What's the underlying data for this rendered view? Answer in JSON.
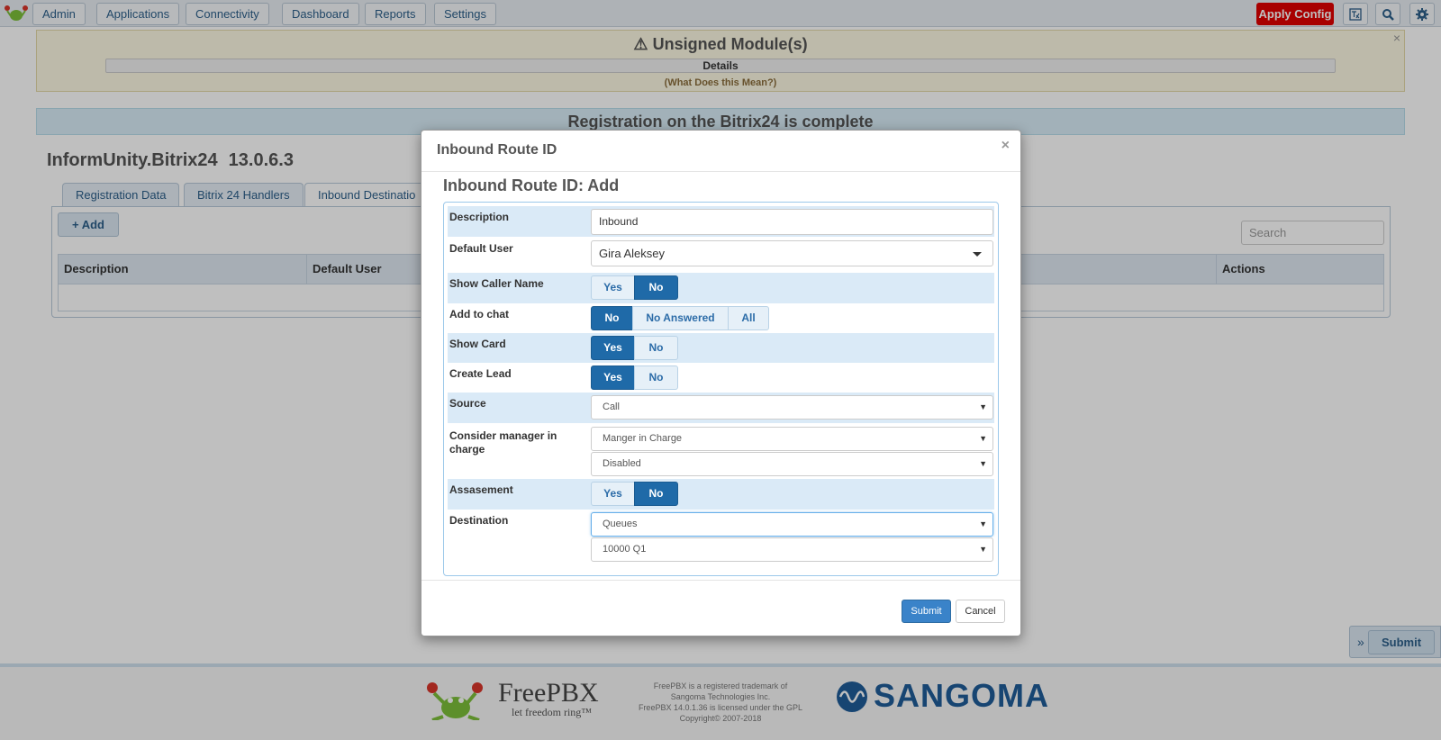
{
  "nav": {
    "items": [
      "Admin",
      "Applications",
      "Connectivity",
      "Dashboard",
      "Reports",
      "Settings"
    ],
    "apply_config": "Apply Config",
    "icons": [
      "translate-icon",
      "search-icon",
      "gear-icon"
    ]
  },
  "alerts": {
    "unsigned_title": "Unsigned Module(s)",
    "details": "Details",
    "what_mean": "(What Does this Mean?)",
    "registration": "Registration on the Bitrix24 is complete"
  },
  "module": {
    "name": "InformUnity.Bitrix24",
    "version": "13.0.6.3"
  },
  "tabs": [
    "Registration Data",
    "Bitrix 24 Handlers",
    "Inbound Destinatio"
  ],
  "list": {
    "add_label": "+ Add",
    "search_placeholder": "Search",
    "columns": [
      "Description",
      "Default User",
      "Actions"
    ]
  },
  "float_submit": "Submit",
  "footer": {
    "freepbx_name": "FreePBX",
    "freepbx_tagline": "let freedom ring™",
    "legal": [
      "FreePBX is a registered trademark of",
      "Sangoma Technologies Inc.",
      "FreePBX 14.0.1.36 is licensed under the GPL",
      "Copyright© 2007-2018"
    ],
    "sangoma": "SANGOMA"
  },
  "modal": {
    "title": "Inbound Route ID",
    "heading": "Inbound Route ID: Add",
    "fields": {
      "description": {
        "label": "Description",
        "value": "Inbound"
      },
      "default_user": {
        "label": "Default User",
        "value": "Gira Aleksey"
      },
      "show_caller_name": {
        "label": "Show Caller Name",
        "options": [
          "Yes",
          "No"
        ],
        "selected": "No"
      },
      "add_to_chat": {
        "label": "Add to chat",
        "options": [
          "No",
          "No Answered",
          "All"
        ],
        "selected": "No"
      },
      "show_card": {
        "label": "Show Card",
        "options": [
          "Yes",
          "No"
        ],
        "selected": "Yes"
      },
      "create_lead": {
        "label": "Create Lead",
        "options": [
          "Yes",
          "No"
        ],
        "selected": "Yes"
      },
      "source": {
        "label": "Source",
        "value": "Call"
      },
      "consider_manager": {
        "label": "Consider manager in charge",
        "value1": "Manger in Charge",
        "value2": "Disabled"
      },
      "assessment": {
        "label": "Assasement",
        "options": [
          "Yes",
          "No"
        ],
        "selected": "No"
      },
      "destination": {
        "label": "Destination",
        "value1": "Queues",
        "value2": "10000 Q1"
      }
    },
    "submit": "Submit",
    "cancel": "Cancel"
  }
}
